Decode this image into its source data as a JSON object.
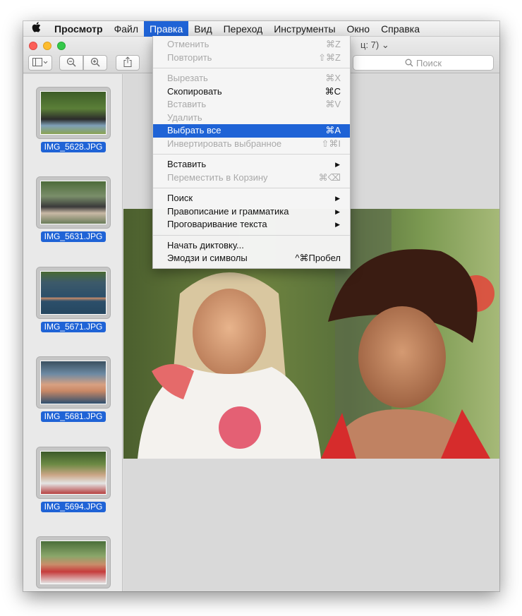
{
  "menubar": {
    "app": "Просмотр",
    "items": [
      "Файл",
      "Правка",
      "Вид",
      "Переход",
      "Инструменты",
      "Окно",
      "Справка"
    ],
    "active": "Правка"
  },
  "window": {
    "title_fragment": "ц: 7)"
  },
  "search": {
    "placeholder": "Поиск"
  },
  "sidebar": {
    "thumbnails": [
      "IMG_5628.JPG",
      "IMG_5631.JPG",
      "IMG_5671.JPG",
      "IMG_5681.JPG",
      "IMG_5694.JPG",
      ""
    ]
  },
  "edit_menu": {
    "undo": {
      "label": "Отменить",
      "shortcut": "⌘Z"
    },
    "redo": {
      "label": "Повторить",
      "shortcut": "⇧⌘Z"
    },
    "cut": {
      "label": "Вырезать",
      "shortcut": "⌘X"
    },
    "copy": {
      "label": "Скопировать",
      "shortcut": "⌘C"
    },
    "paste": {
      "label": "Вставить",
      "shortcut": "⌘V"
    },
    "delete": {
      "label": "Удалить"
    },
    "select_all": {
      "label": "Выбрать все",
      "shortcut": "⌘A"
    },
    "invert_selection": {
      "label": "Инвертировать выбранное",
      "shortcut": "⇧⌘I"
    },
    "insert": {
      "label": "Вставить"
    },
    "move_to_trash": {
      "label": "Переместить в Корзину",
      "shortcut": "⌘⌫"
    },
    "find": {
      "label": "Поиск"
    },
    "spelling": {
      "label": "Правописание и грамматика"
    },
    "speech": {
      "label": "Проговаривание текста"
    },
    "dictation": {
      "label": "Начать диктовку..."
    },
    "emoji": {
      "label": "Эмодзи и символы",
      "shortcut": "^⌘Пробел"
    }
  },
  "colors": {
    "highlight": "#1f63d6",
    "disabled_text": "#a9a9a9"
  }
}
